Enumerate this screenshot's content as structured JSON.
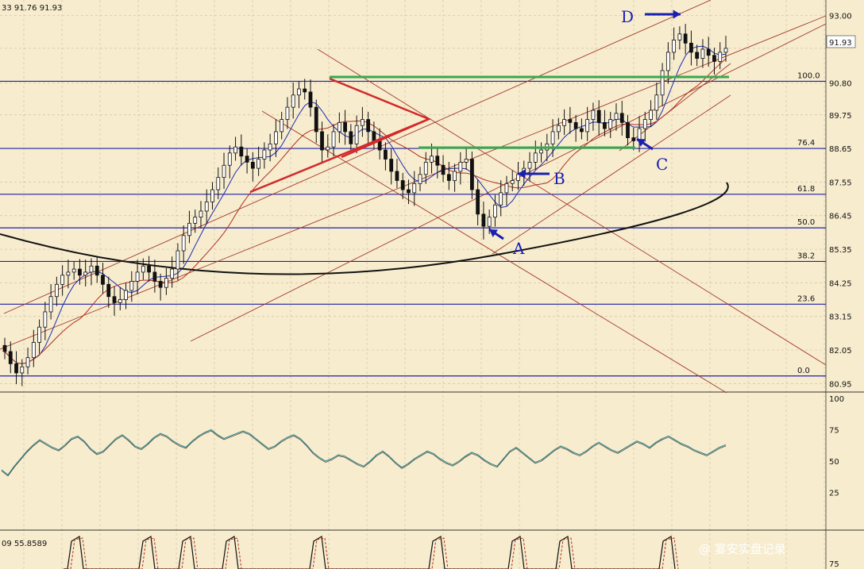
{
  "header": {
    "left_text": "33 91.76 91.93",
    "lower_panel_text": "09 55.8589"
  },
  "price_badge": "91.93",
  "watermark": "@ 宴安实盘记录",
  "chart_data": [
    {
      "type": "candlestick",
      "panel": "price",
      "price_axis": {
        "ticks": [
          "93.00",
          "91.93",
          "90.80",
          "89.75",
          "88.65",
          "87.55",
          "86.45",
          "85.35",
          "84.25",
          "83.15",
          "82.05",
          "80.95"
        ],
        "range": [
          80.7,
          93.2
        ]
      },
      "fibonacci_levels": [
        {
          "label": "100.0",
          "price": 90.85
        },
        {
          "label": "76.4",
          "price": 88.65
        },
        {
          "label": "61.8",
          "price": 87.15
        },
        {
          "label": "50.0",
          "price": 86.05
        },
        {
          "label": "38.2",
          "price": 84.95
        },
        {
          "label": "23.6",
          "price": 83.55
        },
        {
          "label": "0.0",
          "price": 81.2
        }
      ],
      "close_series": [
        82.0,
        81.6,
        81.3,
        81.5,
        81.8,
        82.3,
        82.8,
        83.3,
        83.8,
        84.2,
        84.5,
        84.6,
        84.7,
        84.5,
        84.6,
        84.8,
        84.5,
        84.2,
        83.8,
        83.6,
        83.7,
        84.0,
        84.3,
        84.6,
        84.8,
        84.6,
        84.3,
        84.1,
        84.4,
        84.7,
        85.3,
        85.8,
        86.2,
        86.4,
        86.6,
        86.9,
        87.3,
        87.7,
        88.1,
        88.5,
        88.7,
        88.4,
        88.2,
        88.0,
        88.3,
        88.6,
        88.8,
        89.2,
        89.6,
        90.0,
        90.4,
        90.6,
        90.5,
        90.0,
        89.2,
        88.6,
        88.7,
        89.2,
        89.5,
        89.2,
        88.8,
        89.4,
        89.6,
        89.2,
        88.9,
        88.6,
        88.3,
        87.9,
        87.6,
        87.3,
        87.2,
        87.5,
        87.8,
        88.2,
        88.4,
        88.1,
        87.8,
        87.6,
        87.9,
        88.2,
        88.3,
        87.3,
        86.5,
        86.1,
        86.4,
        86.8,
        87.2,
        87.5,
        87.6,
        87.8,
        88.0,
        88.2,
        88.5,
        88.6,
        88.8,
        89.2,
        89.4,
        89.6,
        89.5,
        89.3,
        89.2,
        89.6,
        89.9,
        89.5,
        89.3,
        89.6,
        89.8,
        89.5,
        89.0,
        88.9,
        89.3,
        89.6,
        89.9,
        90.4,
        91.2,
        91.8,
        92.2,
        92.4,
        92.1,
        91.8,
        91.6,
        91.9,
        91.7,
        91.5,
        91.8,
        91.93
      ],
      "annotations": [
        {
          "label": "A",
          "meaning": "arrow at swing low"
        },
        {
          "label": "B",
          "meaning": "arrow at breakout"
        },
        {
          "label": "C",
          "meaning": "arrow at channel support"
        },
        {
          "label": "D",
          "meaning": "arrow at top"
        }
      ]
    },
    {
      "type": "line",
      "panel": "oscillator",
      "axis_ticks": [
        "100",
        "75",
        "50",
        "25"
      ],
      "range": [
        0,
        100
      ],
      "values": [
        43,
        39,
        46,
        52,
        58,
        63,
        67,
        64,
        61,
        59,
        63,
        68,
        70,
        66,
        60,
        56,
        58,
        63,
        68,
        71,
        67,
        62,
        60,
        64,
        69,
        72,
        70,
        66,
        63,
        61,
        66,
        70,
        73,
        75,
        71,
        68,
        70,
        72,
        74,
        72,
        68,
        64,
        60,
        62,
        66,
        69,
        71,
        68,
        63,
        57,
        53,
        50,
        52,
        55,
        54,
        51,
        48,
        46,
        50,
        55,
        58,
        54,
        49,
        45,
        48,
        52,
        55,
        58,
        56,
        52,
        49,
        47,
        50,
        54,
        57,
        55,
        51,
        48,
        46,
        52,
        58,
        61,
        57,
        53,
        49,
        51,
        55,
        59,
        62,
        60,
        57,
        55,
        58,
        62,
        65,
        62,
        59,
        57,
        60,
        63,
        66,
        64,
        61,
        65,
        68,
        70,
        67,
        64,
        62,
        59,
        57,
        55,
        58,
        61,
        63
      ],
      "series": [
        {
          "name": "55.8589"
        }
      ]
    }
  ]
}
